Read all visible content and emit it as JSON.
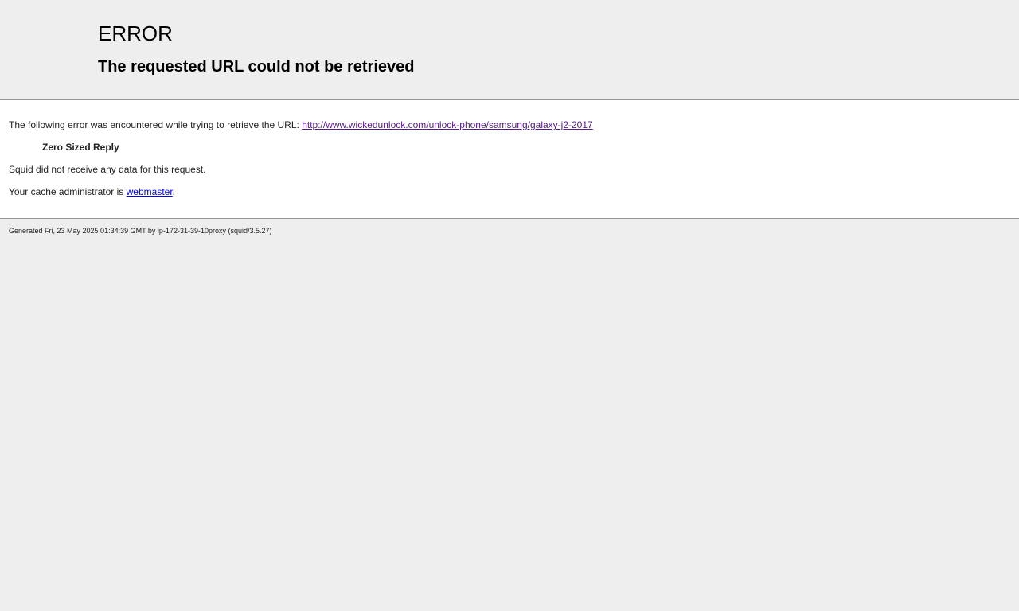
{
  "header": {
    "title": "ERROR",
    "subtitle": "The requested URL could not be retrieved"
  },
  "content": {
    "intro_text": "The following error was encountered while trying to retrieve the URL: ",
    "url": "http://www.wickedunlock.com/unlock-phone/samsung/galaxy-j2-2017",
    "error_name": "Zero Sized Reply",
    "description": "Squid did not receive any data for this request.",
    "admin_prefix": "Your cache administrator is ",
    "admin_link": "webmaster",
    "admin_suffix": "."
  },
  "footer": {
    "generated": "Generated Fri, 23 May 2025 01:34:39 GMT by ip-172-31-39-10proxy (squid/3.5.27)"
  },
  "colors": {
    "page_background": "#eeeeee",
    "content_background": "#ffffff",
    "visited_link": "#551a8b",
    "link": "#0000ee"
  }
}
